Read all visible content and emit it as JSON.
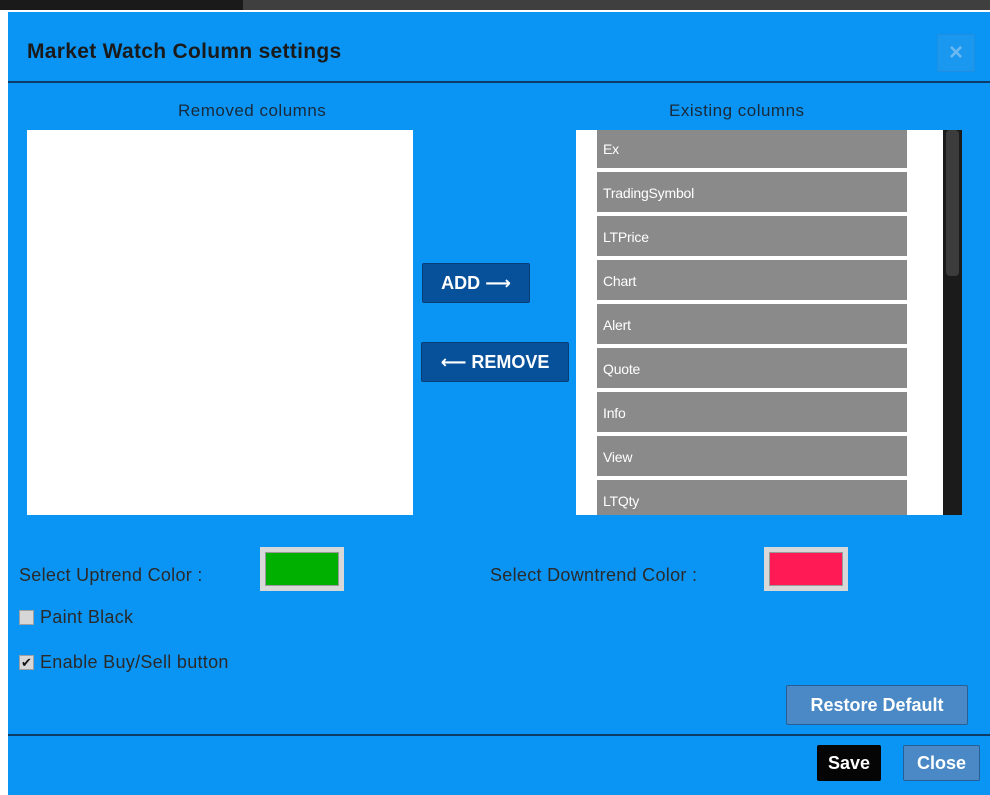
{
  "dialog": {
    "title": "Market Watch Column settings",
    "close_icon": "×"
  },
  "columns": {
    "removed_heading": "Removed columns",
    "existing_heading": "Existing columns",
    "removed_items": [],
    "existing_items": [
      "Ex",
      "TradingSymbol",
      "LTPrice",
      "Chart",
      "Alert",
      "Quote",
      "Info",
      "View",
      "LTQty"
    ]
  },
  "actions": {
    "add_label": "ADD ⟶",
    "remove_label": "⟵ REMOVE"
  },
  "colors": {
    "uptrend_label": "Select Uptrend Color :",
    "uptrend_color": "#00b000",
    "downtrend_label": "Select Downtrend Color :",
    "downtrend_color": "#ff1a55"
  },
  "options": {
    "paint_black_label": "Paint Black",
    "paint_black_checked": false,
    "buy_sell_label": "Enable Buy/Sell button",
    "buy_sell_checked": true,
    "checkmark": "✔"
  },
  "footer": {
    "restore_label": "Restore Default",
    "save_label": "Save",
    "close_label": "Close"
  }
}
